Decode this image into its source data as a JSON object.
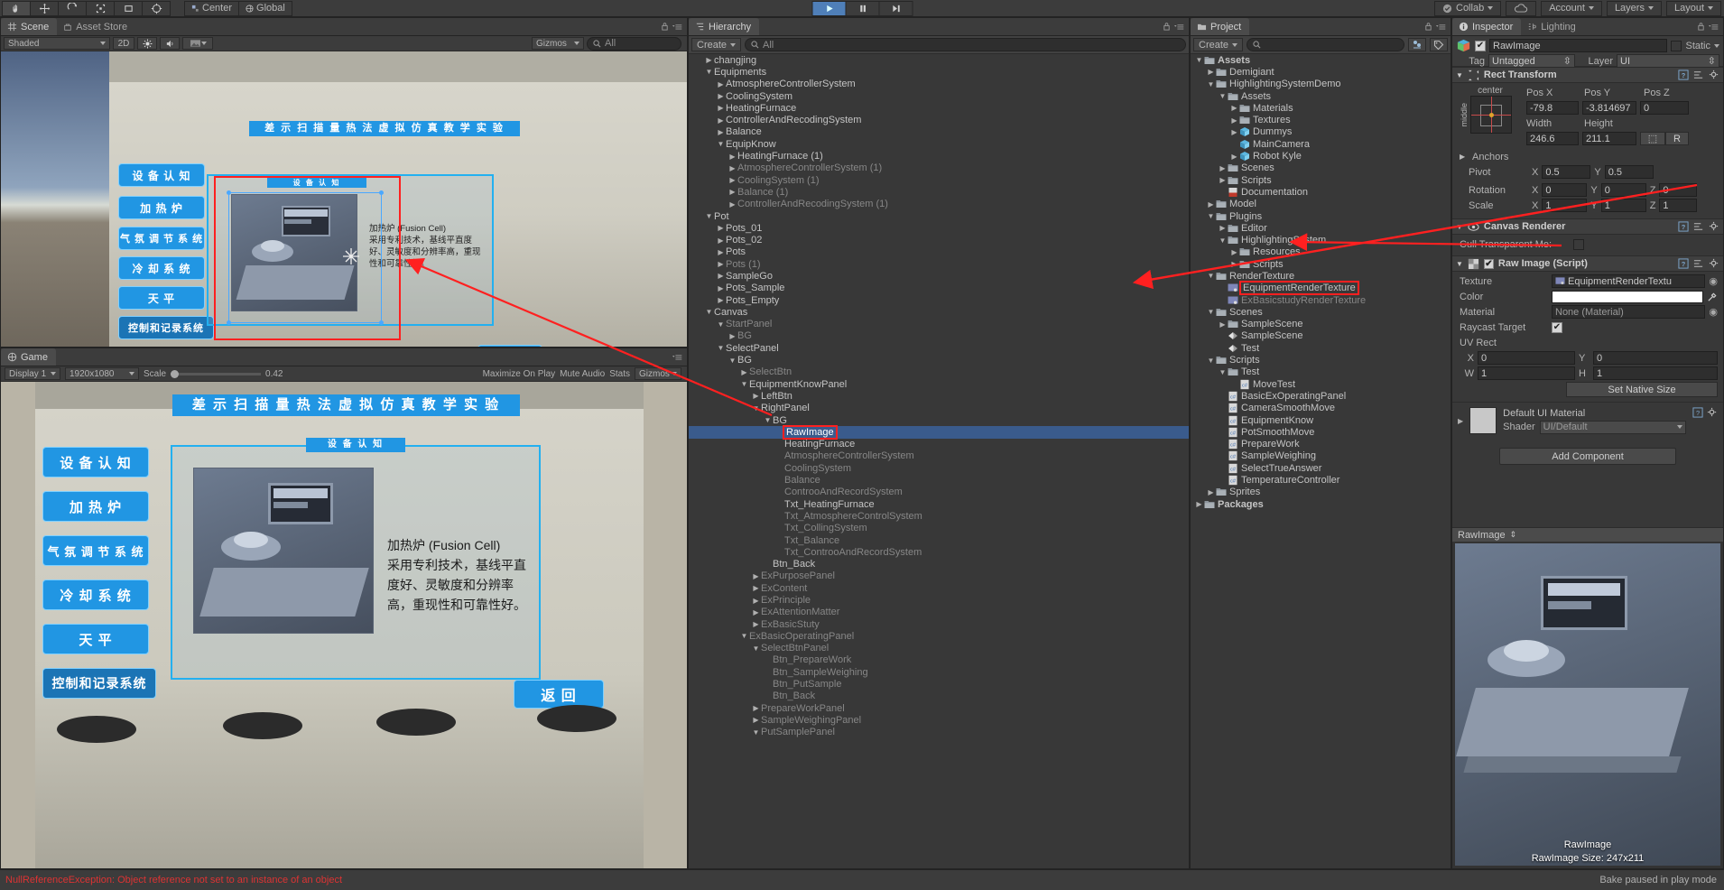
{
  "toolbar": {
    "tools": [
      "hand-tool",
      "move-tool",
      "rotate-tool",
      "scale-tool",
      "rect-tool",
      "transform-tool"
    ],
    "pivot_label": "Center",
    "space_label": "Global",
    "play_label": "play",
    "pause_label": "pause",
    "step_label": "step",
    "collab_label": "Collab",
    "cloud_label": "cloud",
    "account_label": "Account",
    "layers_label": "Layers",
    "layout_label": "Layout"
  },
  "scene": {
    "tab_label": "Scene",
    "tab_asset_store": "Asset Store",
    "shading_mode": "Shaded",
    "mode_2d": "2D",
    "gizmos_label": "Gizmos",
    "search_placeholder": "All"
  },
  "game": {
    "tab_label": "Game",
    "display_label": "Display 1",
    "resolution_label": "1920x1080",
    "scale_label": "Scale",
    "scale_value": "0.42",
    "maximize_label": "Maximize On Play",
    "mute_label": "Mute Audio",
    "stats_label": "Stats",
    "gizmos_label": "Gizmos"
  },
  "sim": {
    "title": "差 示 扫 描 量 热 法 虚 拟 仿 真 教 学 实 验",
    "buttons": [
      "设 备 认 知",
      "加 热 炉",
      "气 氛 调 节 系 统",
      "冷 却 系 统",
      "天   平",
      "控制和记录系统"
    ],
    "panel_title": "设 备 认 知",
    "desc_title": "加热炉 (Fusion Cell)",
    "desc_body": "采用专利技术，基线平直度好、灵敏度和分辨率高，重现性和可靠性好。",
    "back_label": "返  回"
  },
  "hierarchy": {
    "tab_label": "Hierarchy",
    "create_label": "Create",
    "search_placeholder": "All",
    "items": [
      {
        "label": "changjing",
        "indent": 1,
        "arrow": "right",
        "dim": false
      },
      {
        "label": "Equipments",
        "indent": 1,
        "arrow": "down",
        "dim": false
      },
      {
        "label": "AtmosphereControllerSystem",
        "indent": 2,
        "arrow": "right",
        "dim": false
      },
      {
        "label": "CoolingSystem",
        "indent": 2,
        "arrow": "right",
        "dim": false
      },
      {
        "label": "HeatingFurnace",
        "indent": 2,
        "arrow": "right",
        "dim": false
      },
      {
        "label": "ControllerAndRecodingSystem",
        "indent": 2,
        "arrow": "right",
        "dim": false
      },
      {
        "label": "Balance",
        "indent": 2,
        "arrow": "right",
        "dim": false
      },
      {
        "label": "EquipKnow",
        "indent": 2,
        "arrow": "down",
        "dim": false
      },
      {
        "label": "HeatingFurnace (1)",
        "indent": 3,
        "arrow": "right",
        "dim": false
      },
      {
        "label": "AtmosphereControllerSystem (1)",
        "indent": 3,
        "arrow": "right",
        "dim": true
      },
      {
        "label": "CoolingSystem (1)",
        "indent": 3,
        "arrow": "right",
        "dim": true
      },
      {
        "label": "Balance (1)",
        "indent": 3,
        "arrow": "right",
        "dim": true
      },
      {
        "label": "ControllerAndRecodingSystem (1)",
        "indent": 3,
        "arrow": "right",
        "dim": true
      },
      {
        "label": "Pot",
        "indent": 1,
        "arrow": "down",
        "dim": false
      },
      {
        "label": "Pots_01",
        "indent": 2,
        "arrow": "right",
        "dim": false
      },
      {
        "label": "Pots_02",
        "indent": 2,
        "arrow": "right",
        "dim": false
      },
      {
        "label": "Pots",
        "indent": 2,
        "arrow": "right",
        "dim": false
      },
      {
        "label": "Pots (1)",
        "indent": 2,
        "arrow": "right",
        "dim": true
      },
      {
        "label": "SampleGo",
        "indent": 2,
        "arrow": "right",
        "dim": false
      },
      {
        "label": "Pots_Sample",
        "indent": 2,
        "arrow": "right",
        "dim": false
      },
      {
        "label": "Pots_Empty",
        "indent": 2,
        "arrow": "right",
        "dim": false
      },
      {
        "label": "Canvas",
        "indent": 1,
        "arrow": "down",
        "dim": false
      },
      {
        "label": "StartPanel",
        "indent": 2,
        "arrow": "down",
        "dim": true
      },
      {
        "label": "BG",
        "indent": 3,
        "arrow": "right",
        "dim": true
      },
      {
        "label": "SelectPanel",
        "indent": 2,
        "arrow": "down",
        "dim": false
      },
      {
        "label": "BG",
        "indent": 3,
        "arrow": "down",
        "dim": false
      },
      {
        "label": "SelectBtn",
        "indent": 4,
        "arrow": "right",
        "dim": true
      },
      {
        "label": "EquipmentKnowPanel",
        "indent": 4,
        "arrow": "down",
        "dim": false
      },
      {
        "label": "LeftBtn",
        "indent": 5,
        "arrow": "right",
        "dim": false
      },
      {
        "label": "RightPanel",
        "indent": 5,
        "arrow": "down",
        "dim": false
      },
      {
        "label": "BG",
        "indent": 6,
        "arrow": "down",
        "dim": false
      },
      {
        "label": "RawImage",
        "indent": 7,
        "arrow": "none",
        "dim": false,
        "selected": true,
        "highlight": true
      },
      {
        "label": "HeatingFurnace",
        "indent": 7,
        "arrow": "none",
        "dim": false
      },
      {
        "label": "AtmosphereControllerSystem",
        "indent": 7,
        "arrow": "none",
        "dim": true
      },
      {
        "label": "CoolingSystem",
        "indent": 7,
        "arrow": "none",
        "dim": true
      },
      {
        "label": "Balance",
        "indent": 7,
        "arrow": "none",
        "dim": true
      },
      {
        "label": "ControoAndRecordSystem",
        "indent": 7,
        "arrow": "none",
        "dim": true
      },
      {
        "label": "Txt_HeatingFurnace",
        "indent": 7,
        "arrow": "none",
        "dim": false
      },
      {
        "label": "Txt_AtmosphereControlSystem",
        "indent": 7,
        "arrow": "none",
        "dim": true
      },
      {
        "label": "Txt_CollingSystem",
        "indent": 7,
        "arrow": "none",
        "dim": true
      },
      {
        "label": "Txt_Balance",
        "indent": 7,
        "arrow": "none",
        "dim": true
      },
      {
        "label": "Txt_ControoAndRecordSystem",
        "indent": 7,
        "arrow": "none",
        "dim": true
      },
      {
        "label": "Btn_Back",
        "indent": 6,
        "arrow": "none",
        "dim": false
      },
      {
        "label": "ExPurposePanel",
        "indent": 5,
        "arrow": "right",
        "dim": true
      },
      {
        "label": "ExContent",
        "indent": 5,
        "arrow": "right",
        "dim": true
      },
      {
        "label": "ExPrinciple",
        "indent": 5,
        "arrow": "right",
        "dim": true
      },
      {
        "label": "ExAttentionMatter",
        "indent": 5,
        "arrow": "right",
        "dim": true
      },
      {
        "label": "ExBasicStuty",
        "indent": 5,
        "arrow": "right",
        "dim": true
      },
      {
        "label": "ExBasicOperatingPanel",
        "indent": 4,
        "arrow": "down",
        "dim": true
      },
      {
        "label": "SelectBtnPanel",
        "indent": 5,
        "arrow": "down",
        "dim": true
      },
      {
        "label": "Btn_PrepareWork",
        "indent": 6,
        "arrow": "none",
        "dim": true
      },
      {
        "label": "Btn_SampleWeighing",
        "indent": 6,
        "arrow": "none",
        "dim": true
      },
      {
        "label": "Btn_PutSample",
        "indent": 6,
        "arrow": "none",
        "dim": true
      },
      {
        "label": "Btn_Back",
        "indent": 6,
        "arrow": "none",
        "dim": true
      },
      {
        "label": "PrepareWorkPanel",
        "indent": 5,
        "arrow": "right",
        "dim": true
      },
      {
        "label": "SampleWeighingPanel",
        "indent": 5,
        "arrow": "right",
        "dim": true
      },
      {
        "label": "PutSamplePanel",
        "indent": 5,
        "arrow": "down",
        "dim": true
      }
    ]
  },
  "project": {
    "tab_label": "Project",
    "create_label": "Create",
    "search_placeholder": "",
    "items": [
      {
        "label": "Assets",
        "indent": 0,
        "arrow": "down",
        "icon": "folder",
        "bold": true
      },
      {
        "label": "Demigiant",
        "indent": 1,
        "arrow": "right",
        "icon": "folder"
      },
      {
        "label": "HighlightingSystemDemo",
        "indent": 1,
        "arrow": "down",
        "icon": "folder"
      },
      {
        "label": "Assets",
        "indent": 2,
        "arrow": "down",
        "icon": "folder"
      },
      {
        "label": "Materials",
        "indent": 3,
        "arrow": "right",
        "icon": "folder"
      },
      {
        "label": "Textures",
        "indent": 3,
        "arrow": "right",
        "icon": "folder"
      },
      {
        "label": "Dummys",
        "indent": 3,
        "arrow": "right",
        "icon": "prefab"
      },
      {
        "label": "MainCamera",
        "indent": 3,
        "arrow": "none",
        "icon": "prefab"
      },
      {
        "label": "Robot Kyle",
        "indent": 3,
        "arrow": "right",
        "icon": "prefab"
      },
      {
        "label": "Scenes",
        "indent": 2,
        "arrow": "right",
        "icon": "folder"
      },
      {
        "label": "Scripts",
        "indent": 2,
        "arrow": "right",
        "icon": "folder"
      },
      {
        "label": "Documentation",
        "indent": 2,
        "arrow": "none",
        "icon": "pdf"
      },
      {
        "label": "Model",
        "indent": 1,
        "arrow": "right",
        "icon": "folder"
      },
      {
        "label": "Plugins",
        "indent": 1,
        "arrow": "down",
        "icon": "folder"
      },
      {
        "label": "Editor",
        "indent": 2,
        "arrow": "right",
        "icon": "folder"
      },
      {
        "label": "HighlightingSystem",
        "indent": 2,
        "arrow": "down",
        "icon": "folder"
      },
      {
        "label": "Resources",
        "indent": 3,
        "arrow": "right",
        "icon": "folder"
      },
      {
        "label": "Scripts",
        "indent": 3,
        "arrow": "right",
        "icon": "folder"
      },
      {
        "label": "RenderTexture",
        "indent": 1,
        "arrow": "down",
        "icon": "folder"
      },
      {
        "label": "EquipmentRenderTexture",
        "indent": 2,
        "arrow": "none",
        "icon": "rendertexture",
        "highlight": true
      },
      {
        "label": "ExBasicstudyRenderTexture",
        "indent": 2,
        "arrow": "none",
        "icon": "rendertexture",
        "dim": true
      },
      {
        "label": "Scenes",
        "indent": 1,
        "arrow": "down",
        "icon": "folder"
      },
      {
        "label": "SampleScene",
        "indent": 2,
        "arrow": "right",
        "icon": "folder"
      },
      {
        "label": "SampleScene",
        "indent": 2,
        "arrow": "none",
        "icon": "scene"
      },
      {
        "label": "Test",
        "indent": 2,
        "arrow": "none",
        "icon": "scene"
      },
      {
        "label": "Scripts",
        "indent": 1,
        "arrow": "down",
        "icon": "folder"
      },
      {
        "label": "Test",
        "indent": 2,
        "arrow": "down",
        "icon": "folder"
      },
      {
        "label": "MoveTest",
        "indent": 3,
        "arrow": "none",
        "icon": "cs"
      },
      {
        "label": "BasicExOperatingPanel",
        "indent": 2,
        "arrow": "none",
        "icon": "cs"
      },
      {
        "label": "CameraSmoothMove",
        "indent": 2,
        "arrow": "none",
        "icon": "cs"
      },
      {
        "label": "EquipmentKnow",
        "indent": 2,
        "arrow": "none",
        "icon": "cs"
      },
      {
        "label": "PotSmoothMove",
        "indent": 2,
        "arrow": "none",
        "icon": "cs"
      },
      {
        "label": "PrepareWork",
        "indent": 2,
        "arrow": "none",
        "icon": "cs"
      },
      {
        "label": "SampleWeighing",
        "indent": 2,
        "arrow": "none",
        "icon": "cs"
      },
      {
        "label": "SelectTrueAnswer",
        "indent": 2,
        "arrow": "none",
        "icon": "cs"
      },
      {
        "label": "TemperatureController",
        "indent": 2,
        "arrow": "none",
        "icon": "cs"
      },
      {
        "label": "Sprites",
        "indent": 1,
        "arrow": "right",
        "icon": "folder"
      },
      {
        "label": "Packages",
        "indent": 0,
        "arrow": "right",
        "icon": "folder",
        "bold": true
      }
    ]
  },
  "inspector": {
    "tab_label": "Inspector",
    "tab_lighting": "Lighting",
    "object_name": "RawImage",
    "static_label": "Static",
    "tag_label": "Tag",
    "tag_value": "Untagged",
    "layer_label": "Layer",
    "layer_value": "UI",
    "rect_transform": {
      "title": "Rect Transform",
      "anchor_preset": "center",
      "anchor_preset_v": "middle",
      "pos_x_label": "Pos X",
      "pos_x": "-79.8",
      "pos_y_label": "Pos Y",
      "pos_y": "-3.814697",
      "pos_z_label": "Pos Z",
      "pos_z": "0",
      "width_label": "Width",
      "width": "246.6",
      "height_label": "Height",
      "height": "211.1",
      "blueprint_label": "R",
      "anchors_label": "Anchors",
      "pivot_label": "Pivot",
      "pivot_x": "0.5",
      "pivot_y": "0.5",
      "rotation_label": "Rotation",
      "rot_x": "0",
      "rot_y": "0",
      "rot_z": "0",
      "scale_label": "Scale",
      "scale_x": "1",
      "scale_y": "1",
      "scale_z": "1"
    },
    "canvas_renderer": {
      "title": "Canvas Renderer",
      "cull_label": "Cull Transparent Me:"
    },
    "raw_image": {
      "title": "Raw Image (Script)",
      "texture_label": "Texture",
      "texture_value": "EquipmentRenderTextu",
      "color_label": "Color",
      "color_value": "#FFFFFF",
      "material_label": "Material",
      "material_value": "None (Material)",
      "raycast_label": "Raycast Target",
      "uvrect_label": "UV Rect",
      "uv_x_label": "X",
      "uv_x": "0",
      "uv_y_label": "Y",
      "uv_y": "0",
      "uv_w_label": "W",
      "uv_w": "1",
      "uv_h_label": "H",
      "uv_h": "1",
      "native_size_label": "Set Native Size"
    },
    "material": {
      "title": "Default UI Material",
      "shader_label": "Shader",
      "shader_value": "UI/Default"
    },
    "add_component_label": "Add Component",
    "preview": {
      "title": "RawImage",
      "name": "RawImage",
      "size_label": "RawImage Size: 247x211"
    }
  },
  "status": {
    "error": "NullReferenceException: Object reference not set to an instance of an object",
    "bake": "Bake paused in play mode"
  },
  "colors": {
    "accent_blue": "#2196e3",
    "selection_blue": "#3a5b8c",
    "annotation_red": "#ff2020",
    "panel_bg": "#383838"
  }
}
